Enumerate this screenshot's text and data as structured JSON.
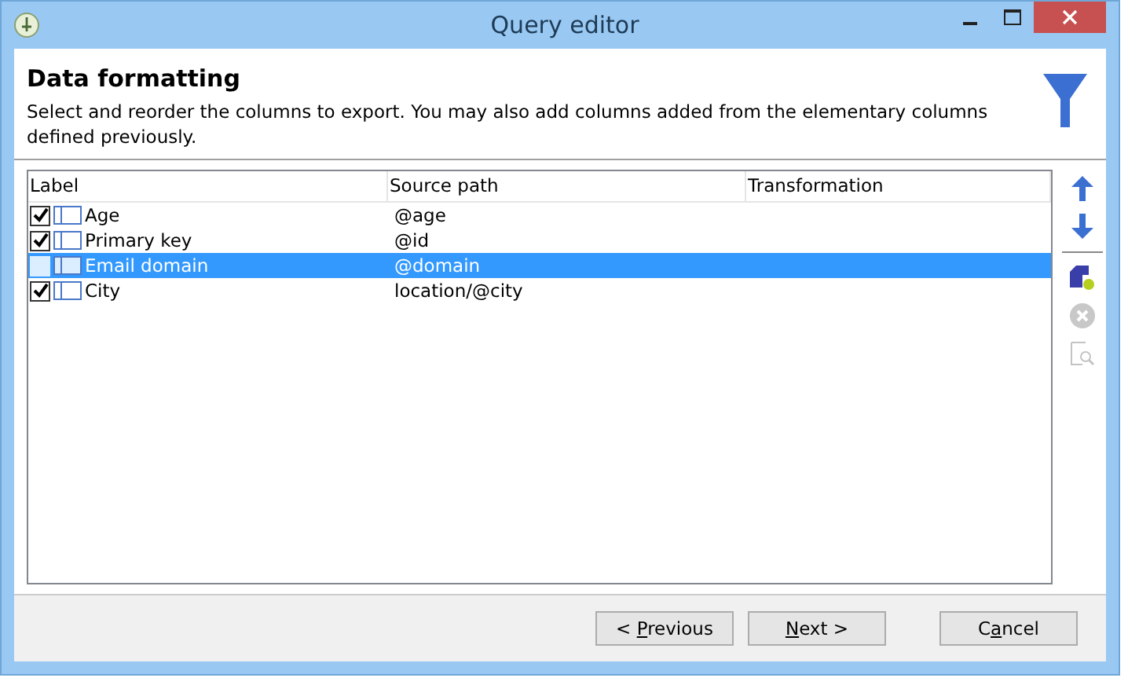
{
  "window": {
    "title": "Query editor"
  },
  "header": {
    "title": "Data formatting",
    "description": "Select and reorder the columns to export. You may also add columns added from the elementary columns defined previously."
  },
  "table": {
    "columns": [
      "Label",
      "Source path",
      "Transformation"
    ],
    "rows": [
      {
        "label": "Age",
        "source_path": "@age",
        "checked": true,
        "selected": false
      },
      {
        "label": "Primary key",
        "source_path": "@id",
        "checked": true,
        "selected": false
      },
      {
        "label": "Email domain",
        "source_path": "@domain",
        "checked": false,
        "selected": true
      },
      {
        "label": "City",
        "source_path": "location/@city",
        "checked": true,
        "selected": false
      }
    ]
  },
  "tools": [
    {
      "kind": "up",
      "disabled": false
    },
    {
      "kind": "down",
      "disabled": false
    },
    {
      "kind": "add",
      "disabled": false
    },
    {
      "kind": "delete",
      "disabled": true
    },
    {
      "kind": "preview",
      "disabled": true
    }
  ],
  "buttons": [
    {
      "pre": "< ",
      "key": "P",
      "post": "revious"
    },
    {
      "key": "N",
      "post": "ext >"
    },
    {
      "pre": "C",
      "key": "a",
      "post": "ncel"
    }
  ]
}
